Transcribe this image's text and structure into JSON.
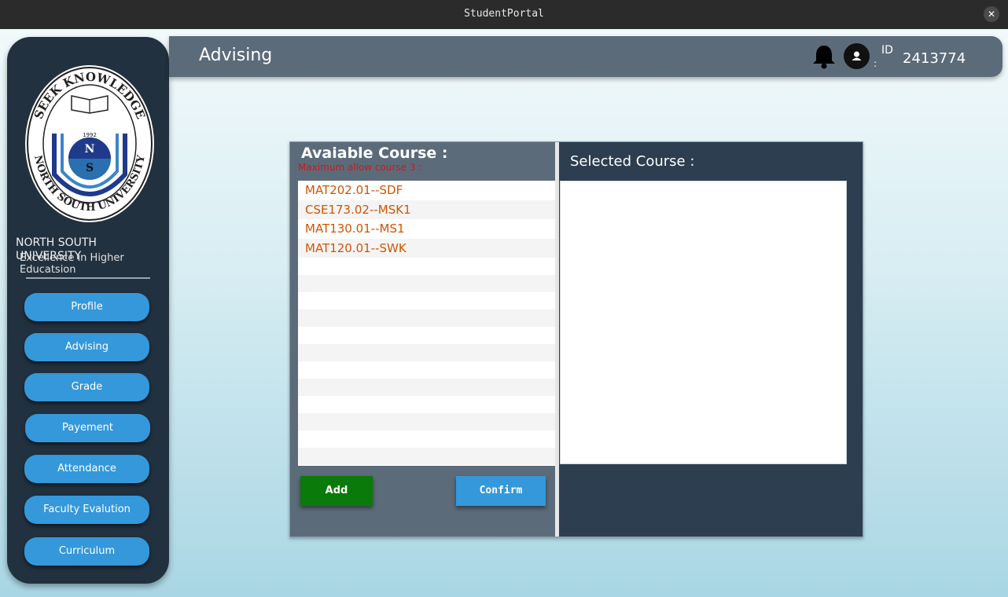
{
  "window": {
    "title": "StudentPortal",
    "close_glyph": "✕"
  },
  "header": {
    "page_title": "Advising",
    "id_label": "ID",
    "id_colon": ":",
    "id_value": "2413774",
    "bell_icon": "bell-icon",
    "avatar_icon": "user-avatar-icon"
  },
  "sidebar": {
    "university_name": "NORTH SOUTH UNIVERSITY",
    "tagline": "Excellence in Higher Educatsion",
    "logo": {
      "ring_text_top": "SEEK KNOWLEDGE",
      "ring_text_bottom": "NORTH SOUTH UNIVERSITY",
      "year": "1992",
      "letter_top": "N",
      "letter_bottom": "S"
    },
    "nav": [
      {
        "label": "Profile"
      },
      {
        "label": "Advising"
      },
      {
        "label": "Grade"
      },
      {
        "label": "Payement"
      },
      {
        "label": "Attendance"
      },
      {
        "label": "Faculty Evalution"
      },
      {
        "label": "Curriculum"
      }
    ]
  },
  "advising": {
    "available_title": "Avaiable Course :",
    "max_note": "Maximum allow course 3 :",
    "courses": [
      "MAT202.01--SDF",
      "CSE173.02--MSK1",
      "MAT130.01--MS1",
      "MAT120.01--SWK"
    ],
    "add_label": "Add",
    "confirm_label": "Confirm",
    "selected_title": "Selected Course :",
    "selected_courses": []
  },
  "colors": {
    "sidebar_bg": "#22313f",
    "button_blue": "#3498db",
    "add_green": "#0a7a0a",
    "course_text": "#d35400",
    "note_red": "#d01818"
  }
}
